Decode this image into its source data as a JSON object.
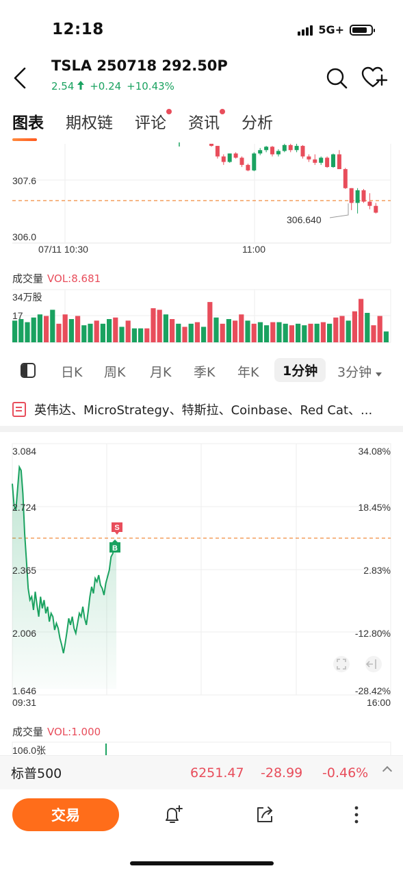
{
  "status_bar": {
    "time": "12:18",
    "network": "5G+",
    "icons": [
      "signal-icon",
      "battery-icon"
    ]
  },
  "header": {
    "title": "TSLA 250718 292.50P",
    "price": "2.54",
    "change": "+0.24",
    "change_pct": "+10.43%",
    "icons": [
      "back-arrow-icon",
      "search-icon",
      "heart-plus-icon"
    ]
  },
  "tabs": [
    {
      "label": "图表",
      "active": true,
      "dot": false
    },
    {
      "label": "期权链",
      "active": false,
      "dot": false
    },
    {
      "label": "评论",
      "active": false,
      "dot": true
    },
    {
      "label": "资讯",
      "active": false,
      "dot": true
    },
    {
      "label": "分析",
      "active": false,
      "dot": false
    }
  ],
  "colors": {
    "up": "#e84d5b",
    "down": "#1aa260",
    "accent": "#ff6d1a",
    "dashed_line": "#f08a3c"
  },
  "underlying_chart": {
    "y_ticks": [
      "307.6",
      "306.0"
    ],
    "x_ticks": [
      "07/11 10:30",
      "11:00"
    ],
    "low_label": "306.640",
    "volume_label": "成交量",
    "volume_value": "VOL:8.681",
    "volume_ticks": [
      "34万股",
      "17"
    ]
  },
  "periods": [
    "日K",
    "周K",
    "月K",
    "季K",
    "年K",
    "1分钟",
    "3分钟"
  ],
  "active_period": "1分钟",
  "news_text": "英伟达、MicroStrategy、特斯拉、Coinbase、Red Cat、...",
  "option_chart": {
    "y_left": [
      "3.084",
      "2.724",
      "2.365",
      "2.006",
      "1.646"
    ],
    "y_right": [
      "34.08%",
      "18.45%",
      "2.83%",
      "-12.80%",
      "-28.42%"
    ],
    "x_start": "09:31",
    "x_end": "16:00",
    "sell_marker": "S",
    "buy_marker": "B",
    "volume_label": "成交量",
    "volume_value": "VOL:1.000",
    "volume_tick": "106.0张"
  },
  "index_bar": {
    "name": "标普500",
    "value": "6251.47",
    "change": "-28.99",
    "change_pct": "-0.46%"
  },
  "toolbar": {
    "trade_label": "交易",
    "icons": [
      "bell-plus-icon",
      "share-icon",
      "more-icon"
    ]
  },
  "chart_data": [
    {
      "type": "candlestick",
      "title": "",
      "x_ticks": [
        "07/11 10:30",
        "11:00"
      ],
      "y_ticks": [
        307.6,
        306.0
      ],
      "ylim": [
        306.0,
        308.35
      ],
      "reference_line": 306.86,
      "annotation": "306.640",
      "candles": [
        [
          308.35,
          308.35,
          308.28,
          308.3
        ],
        [
          308.3,
          308.3,
          308.0,
          308.05
        ],
        [
          308.05,
          308.1,
          307.85,
          307.92
        ],
        [
          307.92,
          308.12,
          307.9,
          308.12
        ],
        [
          308.12,
          308.15,
          308.0,
          308.02
        ],
        [
          308.02,
          308.05,
          307.8,
          307.85
        ],
        [
          307.85,
          307.88,
          307.7,
          307.72
        ],
        [
          307.72,
          308.15,
          307.7,
          308.12
        ],
        [
          308.12,
          308.25,
          308.08,
          308.2
        ],
        [
          308.2,
          308.3,
          308.15,
          308.28
        ],
        [
          308.28,
          308.3,
          308.05,
          308.1
        ],
        [
          308.1,
          308.22,
          308.05,
          308.18
        ],
        [
          308.18,
          308.35,
          308.15,
          308.32
        ],
        [
          308.32,
          308.35,
          308.15,
          308.2
        ],
        [
          308.2,
          308.35,
          308.15,
          308.3
        ],
        [
          308.3,
          308.32,
          308.0,
          308.05
        ],
        [
          308.05,
          308.1,
          307.92,
          307.98
        ],
        [
          307.98,
          308.1,
          307.85,
          307.9
        ],
        [
          307.9,
          308.05,
          307.85,
          308.02
        ],
        [
          308.02,
          308.05,
          307.78,
          307.8
        ],
        [
          307.8,
          308.12,
          307.78,
          308.1
        ],
        [
          308.1,
          308.2,
          307.75,
          307.75
        ],
        [
          307.75,
          307.78,
          307.28,
          307.3
        ],
        [
          307.3,
          307.3,
          306.78,
          306.95
        ],
        [
          306.95,
          307.3,
          306.7,
          307.25
        ],
        [
          307.25,
          307.28,
          306.95,
          306.98
        ],
        [
          306.98,
          307.18,
          306.8,
          306.88
        ],
        [
          306.88,
          306.95,
          306.7,
          306.72
        ]
      ],
      "volume": [
        {
          "v": 14,
          "up": false
        },
        {
          "v": 15,
          "up": false
        },
        {
          "v": 13,
          "up": false
        },
        {
          "v": 16,
          "up": false
        },
        {
          "v": 18,
          "up": false
        },
        {
          "v": 17,
          "up": true
        },
        {
          "v": 21,
          "up": false
        },
        {
          "v": 12,
          "up": true
        },
        {
          "v": 18,
          "up": true
        },
        {
          "v": 15,
          "up": false
        },
        {
          "v": 17,
          "up": true
        },
        {
          "v": 11,
          "up": false
        },
        {
          "v": 12,
          "up": false
        },
        {
          "v": 14,
          "up": true
        },
        {
          "v": 12,
          "up": false
        },
        {
          "v": 15,
          "up": false
        },
        {
          "v": 16,
          "up": true
        },
        {
          "v": 10,
          "up": false
        },
        {
          "v": 14,
          "up": true
        },
        {
          "v": 9,
          "up": false
        },
        {
          "v": 9,
          "up": false
        },
        {
          "v": 9,
          "up": true
        },
        {
          "v": 22,
          "up": true
        },
        {
          "v": 21,
          "up": true
        },
        {
          "v": 18,
          "up": false
        },
        {
          "v": 15,
          "up": true
        },
        {
          "v": 12,
          "up": false
        },
        {
          "v": 10,
          "up": true
        },
        {
          "v": 12,
          "up": false
        },
        {
          "v": 13,
          "up": true
        },
        {
          "v": 10,
          "up": false
        },
        {
          "v": 26,
          "up": true
        },
        {
          "v": 16,
          "up": false
        },
        {
          "v": 12,
          "up": true
        },
        {
          "v": 15,
          "up": false
        },
        {
          "v": 14,
          "up": true
        },
        {
          "v": 18,
          "up": true
        },
        {
          "v": 14,
          "up": false
        },
        {
          "v": 12,
          "up": true
        },
        {
          "v": 13,
          "up": false
        },
        {
          "v": 11,
          "up": false
        },
        {
          "v": 13,
          "up": true
        },
        {
          "v": 13,
          "up": false
        },
        {
          "v": 12,
          "up": false
        },
        {
          "v": 11,
          "up": true
        },
        {
          "v": 12,
          "up": false
        },
        {
          "v": 11,
          "up": false
        },
        {
          "v": 12,
          "up": true
        },
        {
          "v": 12,
          "up": false
        },
        {
          "v": 13,
          "up": true
        },
        {
          "v": 12,
          "up": false
        },
        {
          "v": 16,
          "up": true
        },
        {
          "v": 17,
          "up": true
        },
        {
          "v": 14,
          "up": false
        },
        {
          "v": 20,
          "up": true
        },
        {
          "v": 28,
          "up": true
        },
        {
          "v": 19,
          "up": false
        },
        {
          "v": 11,
          "up": true
        },
        {
          "v": 17,
          "up": true
        },
        {
          "v": 7,
          "up": false
        }
      ]
    },
    {
      "type": "area",
      "title": "",
      "y_ticks": [
        3.084,
        2.724,
        2.365,
        2.006,
        1.646
      ],
      "ylim": [
        1.646,
        3.084
      ],
      "reference_line": 2.54,
      "x_ticks": [
        "09:31",
        "16:00"
      ],
      "x": [
        0,
        1,
        2,
        3,
        4,
        5,
        6,
        7,
        8,
        9,
        10,
        11,
        12,
        13,
        14,
        15,
        16,
        17,
        18,
        19,
        20,
        21,
        22,
        23,
        24,
        25,
        26,
        27,
        28,
        29,
        30,
        31,
        32,
        33,
        34,
        35,
        36,
        37,
        38,
        39,
        40,
        41,
        42,
        43,
        44,
        45,
        46,
        47,
        48,
        49,
        50,
        51,
        52,
        53,
        54,
        55,
        56,
        57,
        58,
        59,
        60,
        61,
        62,
        63,
        64,
        65,
        66,
        67,
        68,
        69,
        70,
        71,
        72,
        73,
        74,
        75,
        76,
        77,
        78,
        79,
        80,
        81,
        82,
        83,
        84,
        85,
        86,
        87,
        88,
        89,
        90,
        91,
        92,
        93,
        94,
        95,
        96,
        97,
        98,
        99,
        100
      ],
      "y": [
        2.88,
        2.75,
        2.72,
        2.85,
        2.98,
        2.96,
        2.82,
        2.58,
        2.42,
        2.25,
        2.18,
        2.2,
        2.12,
        2.23,
        2.15,
        2.08,
        2.2,
        2.13,
        2.18,
        2.1,
        2.14,
        2.05,
        2.1,
        2.08,
        2.0,
        2.04,
        2.01,
        1.95,
        1.91,
        1.86,
        1.92,
        1.99,
        2.07,
        2.03,
        2.08,
        2.01,
        1.98,
        2.04,
        2.1,
        2.08,
        2.14,
        2.07,
        2.03,
        2.11,
        2.2,
        2.26,
        2.22,
        2.31,
        2.29,
        2.33,
        2.27,
        2.25,
        2.21,
        2.28,
        2.32,
        2.36,
        2.44,
        2.46,
        2.51,
        2.49
      ],
      "markers": [
        {
          "label": "S",
          "x": 59,
          "y": 2.56
        },
        {
          "label": "B",
          "x": 59,
          "y": 2.46
        }
      ]
    }
  ]
}
